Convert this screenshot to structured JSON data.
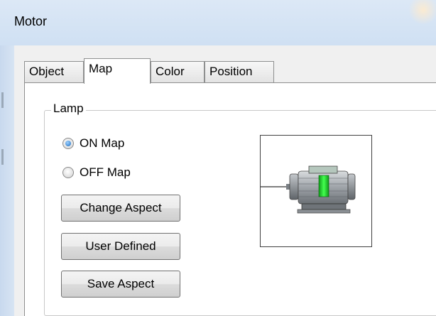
{
  "window": {
    "title": "Motor"
  },
  "tabs": [
    {
      "label": "Object",
      "active": false
    },
    {
      "label": "Map",
      "active": true
    },
    {
      "label": "Color",
      "active": false
    },
    {
      "label": "Position",
      "active": false
    }
  ],
  "group": {
    "label": "Lamp"
  },
  "radios": [
    {
      "label": "ON Map",
      "checked": true
    },
    {
      "label": "OFF Map",
      "checked": false
    }
  ],
  "buttons": {
    "change_aspect": "Change Aspect",
    "user_defined": "User Defined",
    "save_aspect": "Save Aspect"
  },
  "preview": {
    "icon": "motor-icon"
  },
  "colors": {
    "titlebar": "#cfe0f3",
    "radio_checked": "#1c6cc0",
    "motor_body": "#9ea3a8",
    "motor_indicator": "#1fd32a"
  }
}
